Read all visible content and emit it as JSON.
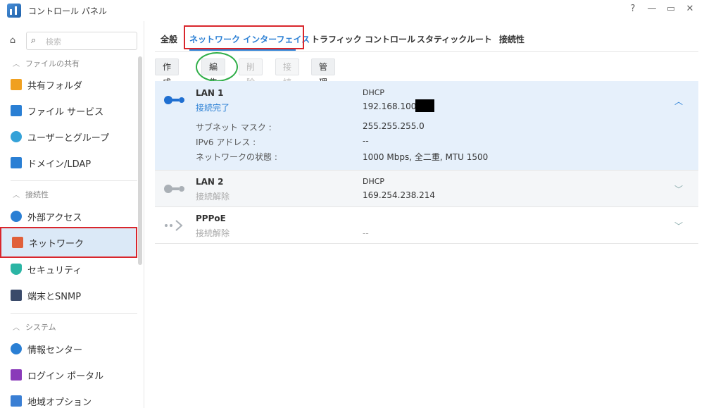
{
  "window": {
    "title": "コントロール パネル",
    "controls": [
      "?",
      "—",
      "▭",
      "✕"
    ]
  },
  "sidebar": {
    "search_placeholder": "検索",
    "sections": [
      {
        "header": "ファイルの共有",
        "items": [
          {
            "label": "共有フォルダ",
            "icon": "folder-share-icon",
            "color": "#f0a020"
          },
          {
            "label": "ファイル サービス",
            "icon": "file-service-icon",
            "color": "#2a7fd4"
          },
          {
            "label": "ユーザーとグループ",
            "icon": "users-icon",
            "color": "#35a2d8"
          },
          {
            "label": "ドメイン/LDAP",
            "icon": "domain-icon",
            "color": "#2a7fd4"
          }
        ]
      },
      {
        "header": "接続性",
        "items": [
          {
            "label": "外部アクセス",
            "icon": "external-access-icon",
            "color": "#2a7fd4"
          },
          {
            "label": "ネットワーク",
            "icon": "network-house-icon",
            "color": "#e0603a"
          },
          {
            "label": "セキュリティ",
            "icon": "shield-icon",
            "color": "#2bb5a4"
          },
          {
            "label": "端末とSNMP",
            "icon": "terminal-icon",
            "color": "#3a4a6a"
          }
        ]
      },
      {
        "header": "システム",
        "items": [
          {
            "label": "情報センター",
            "icon": "info-icon",
            "color": "#2a7fd4"
          },
          {
            "label": "ログイン ポータル",
            "icon": "login-portal-icon",
            "color": "#8a3ab9"
          },
          {
            "label": "地域オプション",
            "icon": "region-icon",
            "color": "#3a7fd4"
          }
        ]
      }
    ]
  },
  "tabs": [
    "全般",
    "ネットワーク インターフェイス",
    "トラフィック コントロール",
    "スタティックルート",
    "接続性"
  ],
  "toolbar": {
    "create": "作成 ▾",
    "edit": "編集",
    "delete": "削除",
    "connect": "接続",
    "manage": "管理 ▾"
  },
  "interfaces": [
    {
      "name": "LAN 1",
      "status": "接続完了",
      "mode": "DHCP",
      "ip": "192.168.100",
      "details": [
        {
          "label": "サブネット マスク :",
          "value": "255.255.255.0"
        },
        {
          "label": "IPv6 アドレス :",
          "value": "--"
        },
        {
          "label": "ネットワークの状態 :",
          "value": "1000 Mbps, 全二重, MTU 1500"
        }
      ]
    },
    {
      "name": "LAN 2",
      "status": "接続解除",
      "mode": "DHCP",
      "ip": "169.254.238.214"
    },
    {
      "name": "PPPoE",
      "status": "接続解除",
      "mode": "",
      "ip": "--"
    }
  ],
  "colors": {
    "accent": "#2a7fd4",
    "highlight_red": "#d9262c",
    "highlight_green": "#2fae48"
  }
}
